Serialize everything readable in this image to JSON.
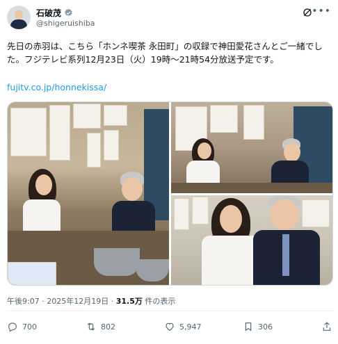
{
  "author": {
    "display_name": "石破茂",
    "handle": "@shigeruishiba"
  },
  "post": {
    "text": "先日の赤羽は、こちら「ホンネ喫茶 永田町」の収録で神田愛花さんとご一緒でした。フジテレビ系列12月23日（火）19時〜21時54分放送予定です。",
    "link": "fujitv.co.jp/honnekissa/"
  },
  "meta": {
    "time": "午後9:07",
    "date": "2025年12月19日",
    "separator": "·",
    "views_count": "31.5万",
    "views_label": "件の表示"
  },
  "actions": {
    "replies": "700",
    "reposts": "802",
    "likes": "5,947",
    "bookmarks": "306"
  },
  "colors": {
    "accent": "#1d9bf0",
    "muted": "#536471",
    "text": "#0f1419"
  }
}
